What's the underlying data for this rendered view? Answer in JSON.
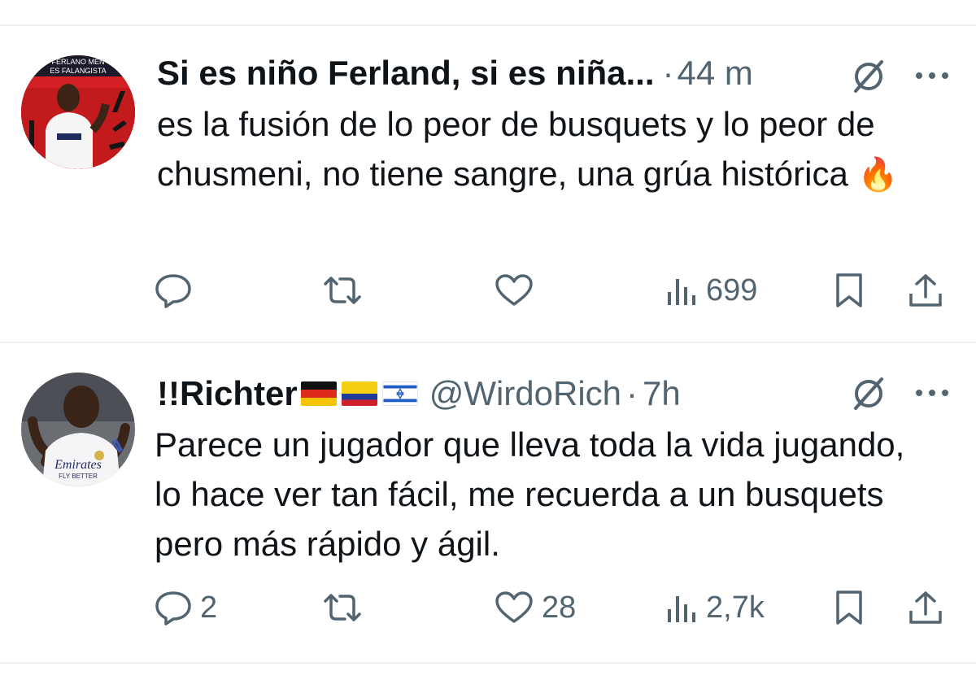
{
  "tweets": [
    {
      "display_name": "Si es niño Ferland, si es niña...",
      "separator": "·",
      "time": "44 m",
      "avatar_text_top": "FERLANO MEN",
      "avatar_text_bottom": "ES FALANGISTA",
      "text": "es la fusión de lo peor de busquets y lo peor de chusmeni, no tiene sangre, una grúa histórica",
      "emoji": "🔥",
      "actions": {
        "reply": "",
        "retweet": "",
        "like": "",
        "views": "699"
      }
    },
    {
      "display_name": "!!Richter",
      "flags": [
        "germany-flag",
        "colombia-flag",
        "israel-flag"
      ],
      "handle": "@WirdoRich",
      "separator": "·",
      "time": "7h",
      "avatar_text_top": "Emirates",
      "avatar_text_bottom": "FLY BETTER",
      "text": "Parece un jugador que lleva toda la vida jugando, lo hace ver tan fácil, me recuerda a un busquets pero más rápido y ágil.",
      "actions": {
        "reply": "2",
        "retweet": "",
        "like": "28",
        "views": "2,7k"
      }
    }
  ],
  "colors": {
    "text": "#0f1419",
    "secondary": "#536471",
    "divider": "#eff3f4"
  }
}
